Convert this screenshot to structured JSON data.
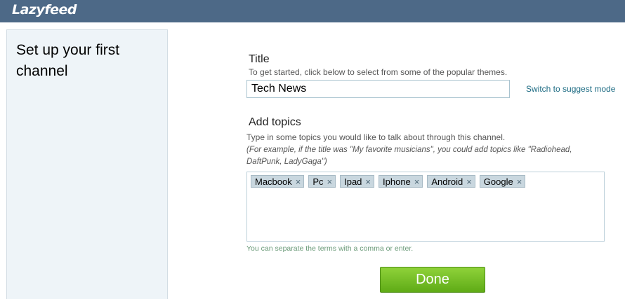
{
  "header": {
    "logo_text": "Lazyfeed"
  },
  "sidebar": {
    "title": "Set up your first channel"
  },
  "form": {
    "title_label": "Title",
    "title_help": "To get started, click below to select from some of the popular themes.",
    "title_value": "Tech News",
    "switch_link": "Switch to suggest mode",
    "topics_label": "Add topics",
    "topics_help": "Type in some topics you would like to talk about through this channel.",
    "topics_example_line1": "(For example, if the title was \"My favorite musicians\", you could add topics like \"Radiohead,",
    "topics_example_line2": "DaftPunk, LadyGaga\")",
    "tags": [
      "Macbook",
      "Pc",
      "Ipad",
      "Iphone",
      "Android",
      "Google"
    ],
    "tag_remove_glyph": "×",
    "separator_hint": "You can separate the terms with a comma or enter.",
    "done_label": "Done"
  },
  "colors": {
    "header_bg": "#4d6987",
    "sidebar_bg": "#eef4f8",
    "link": "#1b6a82",
    "button_green": "#6fbd22",
    "hint_green": "#6a9a78"
  }
}
